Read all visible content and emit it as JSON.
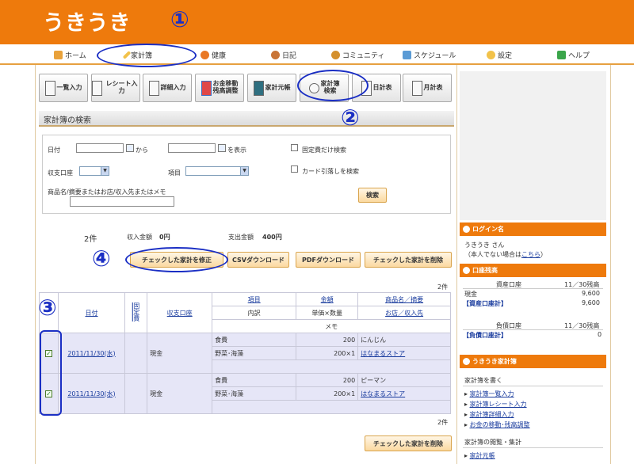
{
  "logo": "うきうき",
  "nav": [
    "ホーム",
    "家計簿",
    "健康",
    "日記",
    "コミュニティ",
    "スケジュール",
    "設定",
    "ヘルプ"
  ],
  "toolbar": {
    "items": [
      "一覧入力",
      "レシート入力",
      "詳細入力",
      "お金移動\n残高調整",
      "家計元帳",
      "家計簿\n検索",
      "日計表",
      "月計表"
    ]
  },
  "search": {
    "title": "家計簿の検索",
    "date_label": "日付",
    "from_label": "から",
    "to_label": "を表示",
    "fixed_only_label": "固定費だけ検索",
    "card_label": "カード引落しを検索",
    "account_label": "収支口座",
    "item_label": "項目",
    "keyword_label": "商品名/摘要またはお店/収入先またはメモ",
    "search_button": "検索"
  },
  "summary": {
    "count": "2件",
    "income_label": "収入金額",
    "income_value": "0円",
    "expense_label": "支出金額",
    "expense_value": "400円"
  },
  "actions": {
    "edit_checked": "チェックした家計を修正",
    "csv": "CSVダウンロード",
    "pdf": "PDFダウンロード",
    "delete_checked": "チェックした家計を削除"
  },
  "table": {
    "count_top": "2件",
    "count_bottom": "2件",
    "headers": {
      "date": "日付",
      "fixed": "固定費",
      "account": "収支口座",
      "item": "項目",
      "amount": "金額",
      "product": "商品名／摘要",
      "detail": "内訳",
      "unit": "単価×数量",
      "shop": "お店／収入先",
      "memo": "メモ"
    },
    "rows": [
      {
        "date": "2011/11/30(水)",
        "account": "現金",
        "item": "食費",
        "amount": "200",
        "product": "にんじん",
        "detail": "野菜･海藻",
        "unit": "200×1",
        "shop": "はなまるストア"
      },
      {
        "date": "2011/11/30(水)",
        "account": "現金",
        "item": "食費",
        "amount": "200",
        "product": "ピーマン",
        "detail": "野菜･海藻",
        "unit": "200×1",
        "shop": "はなまるストア"
      }
    ]
  },
  "sidebar": {
    "login_title": "ログイン名",
    "login_user": "うきうき さん",
    "login_note": "（本人でない場合は",
    "login_link": "こちら",
    "login_note_end": "）",
    "balance_title": "口座残高",
    "asset_label": "資産口座",
    "asset_date": "11／30残高",
    "cash_label": "現金",
    "cash_value": "9,600",
    "asset_total_label": "【資産口座計】",
    "asset_total_value": "9,600",
    "debt_label": "負債口座",
    "debt_date": "11／30残高",
    "debt_total_label": "【負債口座計】",
    "debt_total_value": "0",
    "kakeibo_title": "うきうき家計簿",
    "write_label": "家計簿を書く",
    "links": [
      "家計簿一覧入力",
      "家計簿レシート入力",
      "家計簿詳細入力",
      "お金の移動･残高調整"
    ],
    "browse_label": "家計簿の閲覧・集計",
    "ledger_link": "家計元帳"
  },
  "annotations": [
    "①",
    "②",
    "③",
    "④"
  ],
  "colors": {
    "brand": "#ee7a0c",
    "annotation": "#1b2fc4",
    "row": "#e6e6f7"
  }
}
